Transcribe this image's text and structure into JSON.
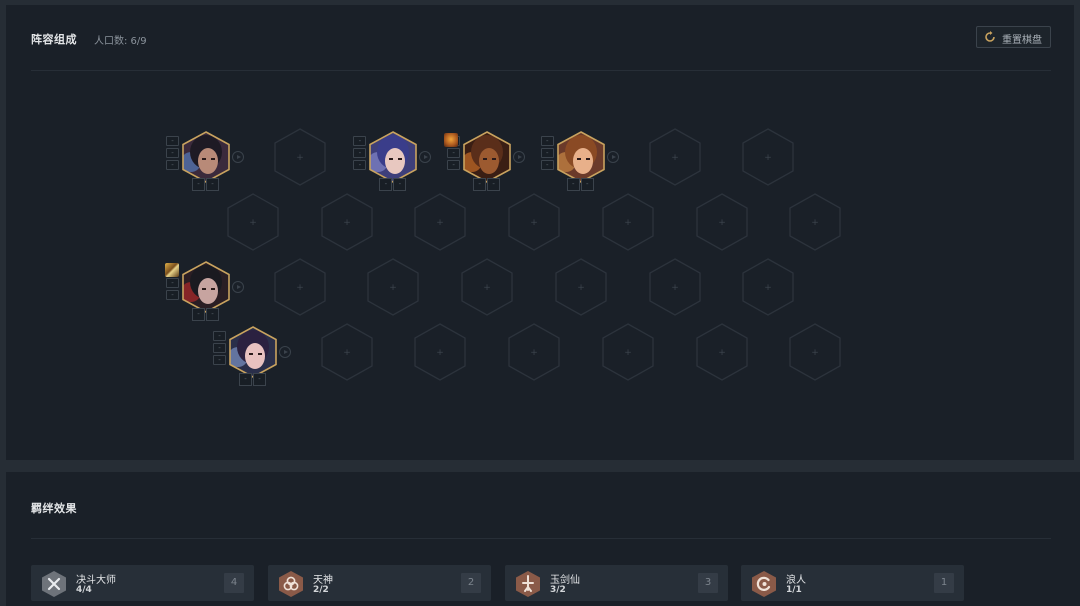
{
  "board": {
    "title": "阵容组成",
    "population_label": "人口数: 6/9",
    "reset_label": "重置棋盘",
    "empty_cell_symbol": "+",
    "slot_symbol": "-",
    "champions": [
      {
        "name": "champion-1",
        "row": 1,
        "col": 1,
        "portrait": {
          "bg": "#3b2a3c",
          "face": "#b88a78",
          "hair": "#1e1a24",
          "accent": "#5b8ad0"
        },
        "items": []
      },
      {
        "name": "champion-2",
        "row": 1,
        "col": 3,
        "portrait": {
          "bg": "#3e3f7a",
          "face": "#e8c8c0",
          "hair": "#3a3d8a",
          "accent": "#8f93d8"
        },
        "items": []
      },
      {
        "name": "champion-3",
        "row": 1,
        "col": 4,
        "portrait": {
          "bg": "#3a1e14",
          "face": "#9c5a30",
          "hair": "#5a2e1a",
          "accent": "#e07a2a"
        },
        "items": [
          "item-emblem"
        ]
      },
      {
        "name": "champion-4",
        "row": 1,
        "col": 5,
        "portrait": {
          "bg": "#6b3a2a",
          "face": "#e8b08a",
          "hair": "#8a4a24",
          "accent": "#d9944a"
        },
        "items": []
      },
      {
        "name": "champion-5",
        "row": 3,
        "col": 1,
        "portrait": {
          "bg": "#2a1e24",
          "face": "#c7a4a0",
          "hair": "#1a1a20",
          "accent": "#c42a2a"
        },
        "items": [
          "item-blade"
        ]
      },
      {
        "name": "champion-6",
        "row": 4,
        "col": 1,
        "portrait": {
          "bg": "#2a2f4a",
          "face": "#e8c2c0",
          "hair": "#2b2140",
          "accent": "#8aa3d8"
        },
        "items": []
      }
    ]
  },
  "traits": {
    "title": "羁绊效果",
    "items": [
      {
        "icon": "crossed-swords-icon",
        "name": "决斗大师",
        "count": "4/4",
        "badge": "4",
        "emblem_color": "#6e737a"
      },
      {
        "icon": "triquetra-icon",
        "name": "天神",
        "count": "2/2",
        "badge": "2",
        "emblem_color": "#8a5a48"
      },
      {
        "icon": "sword-figure-icon",
        "name": "玉剑仙",
        "count": "3/2",
        "badge": "3",
        "emblem_color": "#8a5a48"
      },
      {
        "icon": "wave-icon",
        "name": "浪人",
        "count": "1/1",
        "badge": "1",
        "emblem_color": "#8a5a48"
      }
    ]
  },
  "colors": {
    "gold_border": "#c9a35f",
    "empty_hex_stroke": "#2c333c"
  }
}
